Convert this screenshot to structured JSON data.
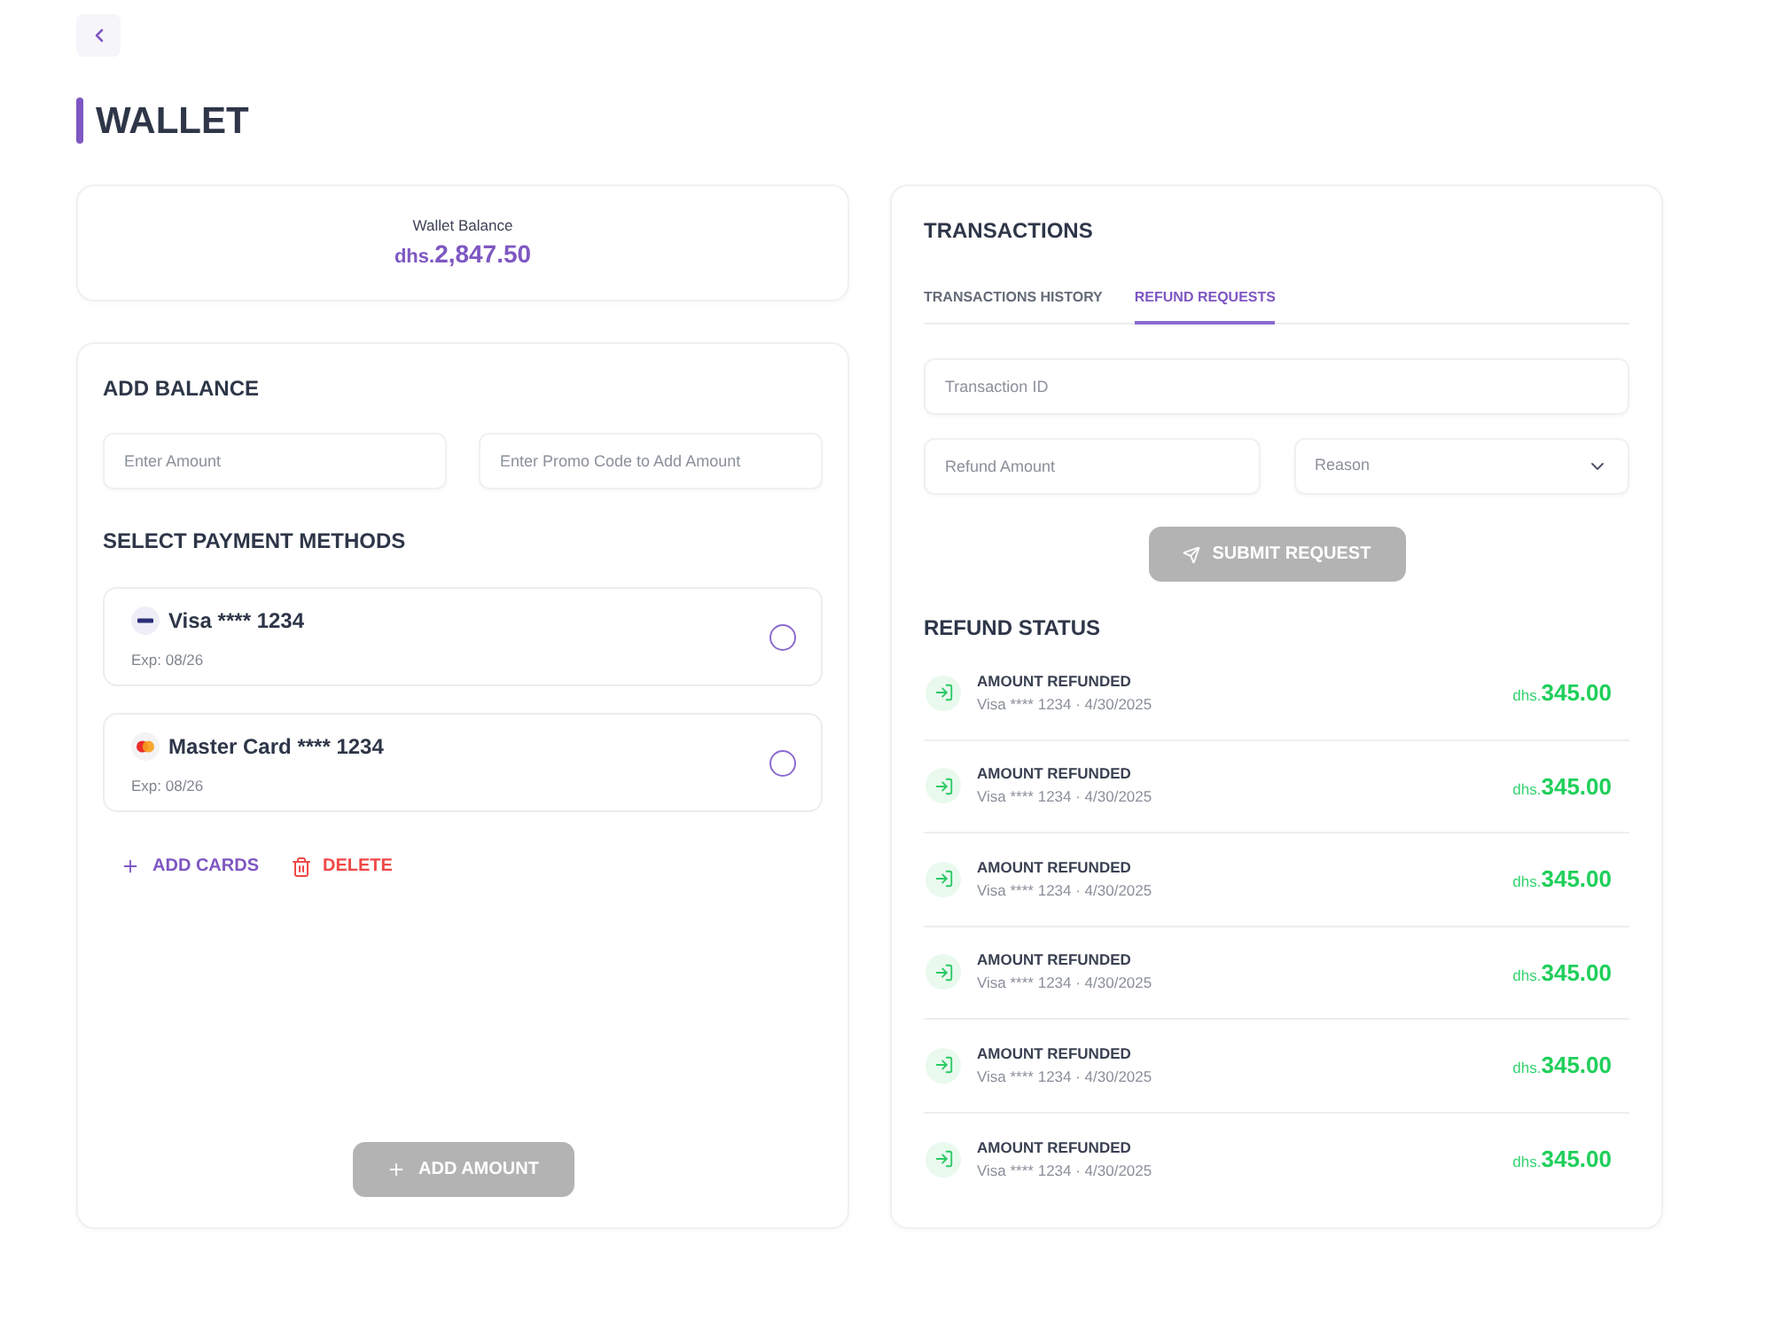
{
  "page_title": "WALLET",
  "balance": {
    "label": "Wallet Balance",
    "currency": "dhs.",
    "amount": "2,847.50"
  },
  "add_balance": {
    "title": "ADD BALANCE",
    "fields": [
      {
        "placeholder": "Enter Amount"
      },
      {
        "placeholder": "Enter Promo Code to Add Amount"
      }
    ],
    "payment_title": "SELECT PAYMENT METHODS",
    "cards": [
      {
        "kind": "visa",
        "name": "Visa **** 1234",
        "expiry": "Exp: 08/26",
        "selected": false
      },
      {
        "kind": "mastercard",
        "name": "Master Card **** 1234",
        "expiry": "Exp: 08/26",
        "selected": false
      }
    ],
    "actions": [
      {
        "kind": "add",
        "label": "ADD CARDS"
      },
      {
        "kind": "delete",
        "label": "DELETE"
      }
    ],
    "submit": {
      "label": "ADD AMOUNT",
      "disabled": true
    }
  },
  "transactions": {
    "title": "TRANSACTIONS",
    "tabs": [
      {
        "label": "TRANSACTIONS HISTORY",
        "selected": false
      },
      {
        "label": "REFUND REQUESTS",
        "selected": true
      }
    ],
    "transaction_id": {
      "placeholder": "Transaction ID"
    },
    "refund_amount": {
      "placeholder": "Refund Amount"
    },
    "reason": {
      "placeholder": "Reason"
    },
    "submit": {
      "label": "SUBMIT REQUEST",
      "disabled": true
    },
    "status_title": "REFUND STATUS",
    "refunds": [
      {
        "status": "AMOUNT REFUNDED",
        "detail": "Visa **** 1234 · 4/30/2025",
        "currency": "dhs.",
        "amount": "345.00"
      },
      {
        "status": "AMOUNT REFUNDED",
        "detail": "Visa **** 1234 · 4/30/2025",
        "currency": "dhs.",
        "amount": "345.00"
      },
      {
        "status": "AMOUNT REFUNDED",
        "detail": "Visa **** 1234 · 4/30/2025",
        "currency": "dhs.",
        "amount": "345.00"
      },
      {
        "status": "AMOUNT REFUNDED",
        "detail": "Visa **** 1234 · 4/30/2025",
        "currency": "dhs.",
        "amount": "345.00"
      },
      {
        "status": "AMOUNT REFUNDED",
        "detail": "Visa **** 1234 · 4/30/2025",
        "currency": "dhs.",
        "amount": "345.00"
      },
      {
        "status": "AMOUNT REFUNDED",
        "detail": "Visa **** 1234 · 4/30/2025",
        "currency": "dhs.",
        "amount": "345.00"
      }
    ]
  }
}
